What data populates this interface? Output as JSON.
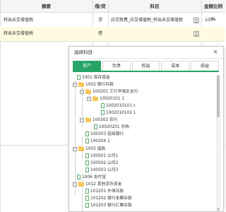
{
  "grid": {
    "headers": {
      "summary": "摘要",
      "direction": "借/贷",
      "subject": "科目",
      "amount_ratio": "金额比例 %"
    },
    "row1": {
      "summary": "转出未交增值税",
      "direction": "贷",
      "subject": "应交税费_应交增值税_转出未交增值税",
      "amount": "100"
    },
    "row2": {
      "summary": "转出未交增值税",
      "direction": "借"
    }
  },
  "dialog": {
    "title": "选择科目",
    "close_label": "×",
    "tabs": [
      "资产",
      "负债",
      "权益",
      "成本",
      "损益"
    ],
    "active_tab": "资产",
    "tree": [
      {
        "label": "1001 库存现金"
      },
      {
        "label": "1002 银行存款"
      },
      {
        "label": "100201 工行华强北支行"
      },
      {
        "label": "10020101 1"
      },
      {
        "label": "1002010101 c"
      },
      {
        "label": "1002010102 1"
      },
      {
        "label": "100202 农行"
      },
      {
        "label": "10020201 乐购"
      },
      {
        "label": "100203 招商银行"
      },
      {
        "label": "100204 1"
      },
      {
        "label": "1005 借款"
      },
      {
        "label": "100501 公司1"
      },
      {
        "label": "100502 公司2"
      },
      {
        "label": "100503 公司3"
      },
      {
        "label": "1006 支付宝"
      },
      {
        "label": "1012 其他货币资金"
      },
      {
        "label": "101201 外埠存款"
      },
      {
        "label": "101202 银行本票存款"
      },
      {
        "label": "101203 银行汇票存款"
      }
    ]
  }
}
